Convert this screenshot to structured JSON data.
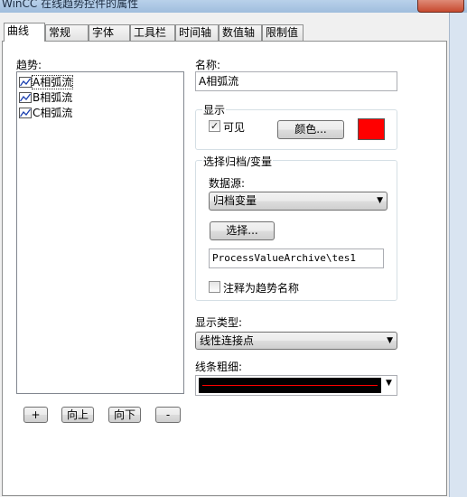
{
  "window": {
    "title": "WinCC 在线趋势控件的属性"
  },
  "tabs": [
    {
      "label": "曲线",
      "active": true
    },
    {
      "label": "常规"
    },
    {
      "label": "字体"
    },
    {
      "label": "工具栏"
    },
    {
      "label": "时间轴"
    },
    {
      "label": "数值轴"
    },
    {
      "label": "限制值"
    }
  ],
  "trends": {
    "label": "趋势:",
    "items": [
      "A相弧流",
      "B相弧流",
      "C相弧流"
    ],
    "selected_index": 0
  },
  "list_buttons": {
    "add": "+",
    "up": "向上",
    "down": "向下",
    "remove": "-"
  },
  "name": {
    "label": "名称:",
    "value": "A相弧流"
  },
  "display": {
    "group_title": "显示",
    "visible_label": "可见",
    "visible_checked": true,
    "color_button": "颜色...",
    "color": "#ff0000"
  },
  "archive": {
    "group_title": "选择归档/变量",
    "datasource_label": "数据源:",
    "datasource_value": "归档变量",
    "select_button": "选择...",
    "path_value": "ProcessValueArchive\\tes1",
    "comment_label": "注释为趋势名称",
    "comment_checked": false
  },
  "display_type": {
    "label": "显示类型:",
    "value": "线性连接点"
  },
  "line_weight": {
    "label": "线条粗细:",
    "line_color": "#ff0000"
  },
  "colors": {
    "tab_border": "#8e8f8f",
    "group_border": "#d5dfe5"
  }
}
